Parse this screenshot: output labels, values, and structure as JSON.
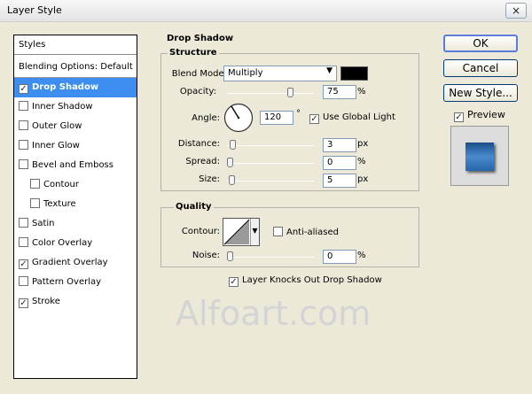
{
  "window": {
    "title": "Layer Style",
    "close_glyph": "×"
  },
  "styles_panel": {
    "header": "Styles",
    "blending_label": "Blending Options: Default",
    "items": [
      {
        "label": "Drop Shadow",
        "checked": true,
        "selected": true,
        "sub": false
      },
      {
        "label": "Inner Shadow",
        "checked": false,
        "selected": false,
        "sub": false
      },
      {
        "label": "Outer Glow",
        "checked": false,
        "selected": false,
        "sub": false
      },
      {
        "label": "Inner Glow",
        "checked": false,
        "selected": false,
        "sub": false
      },
      {
        "label": "Bevel and Emboss",
        "checked": false,
        "selected": false,
        "sub": false
      },
      {
        "label": "Contour",
        "checked": false,
        "selected": false,
        "sub": true
      },
      {
        "label": "Texture",
        "checked": false,
        "selected": false,
        "sub": true
      },
      {
        "label": "Satin",
        "checked": false,
        "selected": false,
        "sub": false
      },
      {
        "label": "Color Overlay",
        "checked": false,
        "selected": false,
        "sub": false
      },
      {
        "label": "Gradient Overlay",
        "checked": true,
        "selected": false,
        "sub": false
      },
      {
        "label": "Pattern Overlay",
        "checked": false,
        "selected": false,
        "sub": false
      },
      {
        "label": "Stroke",
        "checked": true,
        "selected": false,
        "sub": false
      }
    ]
  },
  "drop_shadow": {
    "title": "Drop Shadow",
    "structure": {
      "title": "Structure",
      "blend_mode_label": "Blend Mode:",
      "blend_mode_value": "Multiply",
      "shadow_color": "#000000",
      "opacity_label": "Opacity:",
      "opacity_value": "75",
      "opacity_unit": "%",
      "opacity_level": 0.75,
      "angle_label": "Angle:",
      "angle_value": "120",
      "angle_unit": "°",
      "use_global_light_label": "Use Global Light",
      "use_global_light": true,
      "distance_label": "Distance:",
      "distance_value": "3",
      "distance_unit": "px",
      "distance_level": 0.03,
      "spread_label": "Spread:",
      "spread_value": "0",
      "spread_unit": "%",
      "spread_level": 0,
      "size_label": "Size:",
      "size_value": "5",
      "size_unit": "px",
      "size_level": 0.02
    },
    "quality": {
      "title": "Quality",
      "contour_label": "Contour:",
      "anti_aliased_label": "Anti-aliased",
      "anti_aliased": false,
      "noise_label": "Noise:",
      "noise_value": "0",
      "noise_unit": "%",
      "noise_level": 0
    },
    "knockout_label": "Layer Knocks Out Drop Shadow",
    "knockout": true
  },
  "buttons": {
    "ok": "OK",
    "cancel": "Cancel",
    "new_style": "New Style..."
  },
  "preview": {
    "label": "Preview",
    "checked": true
  },
  "watermark": "Alfoart.com",
  "icons": {
    "checkmark": "✓",
    "dropdown": "▼"
  }
}
